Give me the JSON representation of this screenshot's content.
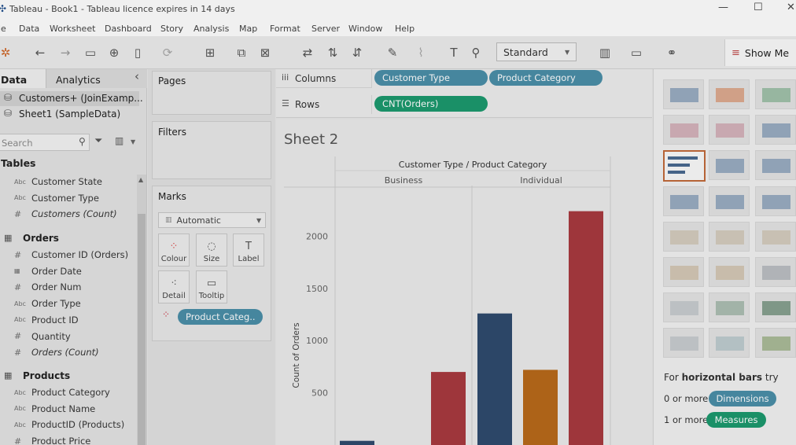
{
  "window": {
    "title": "Tableau - Book1 - Tableau licence expires in 14 days",
    "controls": [
      "—",
      "☐",
      "✕"
    ]
  },
  "menu": [
    "le",
    "Data",
    "Worksheet",
    "Dashboard",
    "Story",
    "Analysis",
    "Map",
    "Format",
    "Server",
    "Window",
    "Help"
  ],
  "toolbar": {
    "fit_dropdown": "Standard",
    "show_me": "Show Me"
  },
  "data_pane": {
    "tab_data": "Data",
    "tab_analytics": "Analytics",
    "collapse": "‹",
    "sources": [
      "Customers+ (JoinExamp...",
      "Sheet1 (SampleData)"
    ],
    "search_placeholder": "Search",
    "tables_header": "Tables",
    "customers_fields": [
      {
        "icon": "Abc",
        "name": "Customer State"
      },
      {
        "icon": "Abc",
        "name": "Customer Type"
      },
      {
        "icon": "#",
        "name": "Customers (Count)"
      }
    ],
    "orders_table": "Orders",
    "orders_fields": [
      {
        "icon": "#",
        "name": "Customer ID (Orders)"
      },
      {
        "icon": "▦",
        "name": "Order Date"
      },
      {
        "icon": "#",
        "name": "Order Num"
      },
      {
        "icon": "Abc",
        "name": "Order Type"
      },
      {
        "icon": "Abc",
        "name": "Product ID"
      },
      {
        "icon": "#",
        "name": "Quantity"
      },
      {
        "icon": "#",
        "name": "Orders (Count)"
      }
    ],
    "products_table": "Products",
    "products_fields": [
      {
        "icon": "Abc",
        "name": "Product Category"
      },
      {
        "icon": "Abc",
        "name": "Product Name"
      },
      {
        "icon": "Abc",
        "name": "ProductID (Products)"
      },
      {
        "icon": "#",
        "name": "Product Price"
      }
    ]
  },
  "cards": {
    "pages": "Pages",
    "filters": "Filters",
    "marks": "Marks",
    "mark_type": "Automatic",
    "buttons": [
      "Colour",
      "Size",
      "Label",
      "Detail",
      "Tooltip"
    ],
    "color_pill": "Product Categ.."
  },
  "shelves": {
    "columns_label": "Columns",
    "rows_label": "Rows",
    "columns_pills": [
      "Customer Type",
      "Product Category"
    ],
    "rows_pills": [
      "CNT(Orders)"
    ]
  },
  "sheet": {
    "title": "Sheet 2"
  },
  "colors": {
    "blue": "#2f4b6e",
    "orange": "#b86a1a",
    "red": "#a83a3f",
    "pill_blue": "#4b8fa8",
    "pill_green": "#1c9a6e"
  },
  "chart_data": {
    "type": "bar",
    "header": "Customer Type / Product Category",
    "panes": [
      "Business",
      "Individual"
    ],
    "ylabel": "Count of Orders",
    "yticks": [
      500,
      1000,
      1500,
      2000
    ],
    "ylim": [
      0,
      2300
    ],
    "series": [
      {
        "pane": "Business",
        "values": [
          40,
          null,
          700
        ]
      },
      {
        "pane": "Individual",
        "values": [
          1260,
          720,
          2240
        ]
      }
    ]
  },
  "show_me": {
    "hint_prefix": "For ",
    "hint_bold": "horizontal bars",
    "hint_suffix": " try",
    "req1": "0 or more",
    "req1_pill": "Dimensions",
    "req2": "1 or more",
    "req2_pill": "Measures"
  }
}
